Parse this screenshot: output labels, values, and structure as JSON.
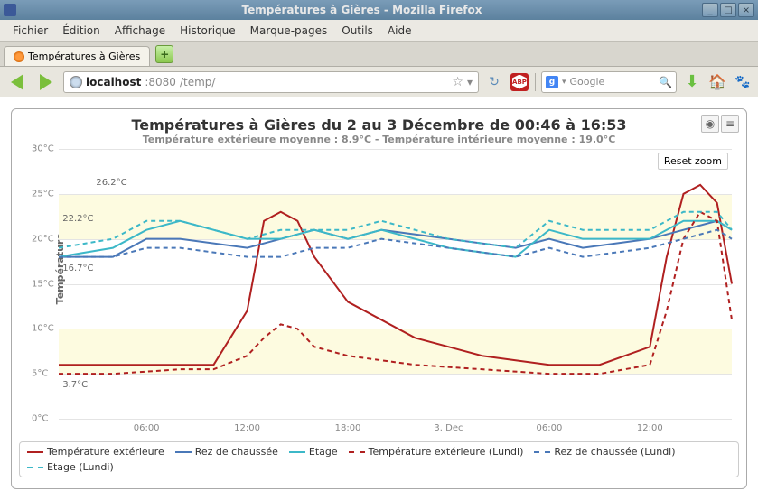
{
  "window": {
    "title": "Températures à Gières - Mozilla Firefox"
  },
  "menu": {
    "items": [
      "Fichier",
      "Édition",
      "Affichage",
      "Historique",
      "Marque-pages",
      "Outils",
      "Aide"
    ]
  },
  "tab": {
    "label": "Températures à Gières"
  },
  "url": {
    "host": "localhost",
    "port": ":8080",
    "path": "/temp/"
  },
  "search": {
    "engine": "Google",
    "placeholder": "Google"
  },
  "chart": {
    "title": "Températures à Gières du 2 au 3 Décembre de 00:46 à 16:53",
    "subtitle": "Température extérieure moyenne : 8.9°C - Température intérieure moyenne : 19.0°C",
    "ylabel": "Température",
    "reset_zoom": "Reset zoom",
    "annotations": {
      "a1": "26.2°C",
      "a2": "22.2°C",
      "a3": "16.7°C",
      "a4": "3.7°C"
    },
    "legend": {
      "s1": "Température extérieure",
      "s2": "Rez de chaussée",
      "s3": "Etage",
      "s4": "Température extérieure (Lundi)",
      "s5": "Rez de chaussée (Lundi)",
      "s6": "Etage (Lundi)"
    }
  },
  "chart_data": {
    "type": "line",
    "ylabel": "Température",
    "ylim": [
      0,
      30
    ],
    "yticks": [
      0,
      5,
      10,
      15,
      20,
      25,
      30
    ],
    "ytick_labels": [
      "0°C",
      "5°C",
      "10°C",
      "15°C",
      "20°C",
      "25°C",
      "30°C"
    ],
    "x_hours": [
      0.77,
      6,
      12,
      18,
      24,
      30,
      36,
      40.88
    ],
    "xtick_hours": [
      6,
      12,
      18,
      24,
      30,
      36
    ],
    "xtick_labels": [
      "06:00",
      "12:00",
      "18:00",
      "3. Dec",
      "06:00",
      "12:00"
    ],
    "annotations": [
      {
        "label": "26.2°C",
        "x": 3,
        "y": 26.2
      },
      {
        "label": "22.2°C",
        "x": 1,
        "y": 22.2
      },
      {
        "label": "16.7°C",
        "x": 1,
        "y": 16.7
      },
      {
        "label": "3.7°C",
        "x": 1,
        "y": 3.7
      }
    ],
    "bands": [
      [
        20,
        25
      ],
      [
        5,
        10
      ]
    ],
    "series": [
      {
        "name": "Température extérieure",
        "color": "#b02020",
        "dash": false,
        "x": [
          0.77,
          4,
          8,
          10,
          12,
          13,
          14,
          15,
          16,
          18,
          22,
          26,
          30,
          33,
          36,
          37,
          38,
          39,
          40,
          40.88
        ],
        "y": [
          6,
          6,
          6,
          6,
          12,
          22,
          23,
          22,
          18,
          13,
          9,
          7,
          6,
          6,
          8,
          18,
          25,
          26,
          24,
          15
        ]
      },
      {
        "name": "Rez de chaussée",
        "color": "#4a78b8",
        "dash": false,
        "x": [
          0.77,
          4,
          6,
          8,
          12,
          14,
          16,
          18,
          20,
          24,
          28,
          30,
          32,
          36,
          38,
          40,
          40.88
        ],
        "y": [
          18,
          18,
          20,
          20,
          19,
          20,
          21,
          20,
          21,
          20,
          19,
          20,
          19,
          20,
          21,
          22,
          21
        ]
      },
      {
        "name": "Etage",
        "color": "#3cb8c8",
        "dash": false,
        "x": [
          0.77,
          4,
          6,
          8,
          12,
          14,
          16,
          18,
          20,
          24,
          28,
          30,
          32,
          36,
          38,
          40,
          40.88
        ],
        "y": [
          18,
          19,
          21,
          22,
          20,
          20,
          21,
          20,
          21,
          19,
          18,
          21,
          20,
          20,
          22,
          22,
          21
        ]
      },
      {
        "name": "Température extérieure (Lundi)",
        "color": "#b02020",
        "dash": true,
        "x": [
          0.77,
          4,
          8,
          10,
          12,
          13,
          14,
          15,
          16,
          18,
          22,
          26,
          30,
          33,
          36,
          37,
          38,
          39,
          40,
          40.88
        ],
        "y": [
          5,
          5,
          5.5,
          5.5,
          7,
          9,
          10.5,
          10,
          8,
          7,
          6,
          5.5,
          5,
          5,
          6,
          12,
          20,
          23,
          22,
          11
        ]
      },
      {
        "name": "Rez de chaussée (Lundi)",
        "color": "#4a78b8",
        "dash": true,
        "x": [
          0.77,
          4,
          6,
          8,
          12,
          14,
          16,
          18,
          20,
          24,
          28,
          30,
          32,
          36,
          38,
          40,
          40.88
        ],
        "y": [
          18,
          18,
          19,
          19,
          18,
          18,
          19,
          19,
          20,
          19,
          18,
          19,
          18,
          19,
          20,
          21,
          20
        ]
      },
      {
        "name": "Etage (Lundi)",
        "color": "#3cb8c8",
        "dash": true,
        "x": [
          0.77,
          4,
          6,
          8,
          12,
          14,
          16,
          18,
          20,
          24,
          28,
          30,
          32,
          36,
          38,
          40,
          40.88
        ],
        "y": [
          19,
          20,
          22,
          22,
          20,
          21,
          21,
          21,
          22,
          20,
          19,
          22,
          21,
          21,
          23,
          23,
          21
        ]
      }
    ]
  }
}
